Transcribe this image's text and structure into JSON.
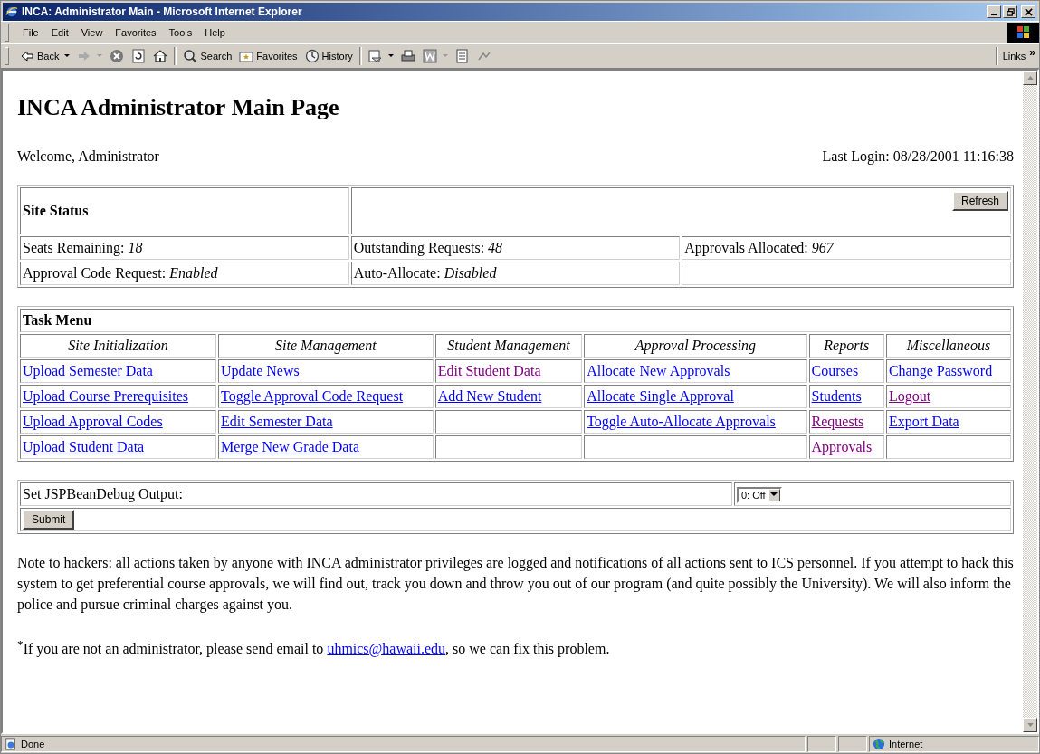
{
  "window": {
    "title": "INCA: Administrator Main - Microsoft Internet Explorer"
  },
  "menu": [
    "File",
    "Edit",
    "View",
    "Favorites",
    "Tools",
    "Help"
  ],
  "toolbar": [
    {
      "kind": "back",
      "label": "Back"
    },
    {
      "kind": "forward"
    },
    {
      "kind": "stop"
    },
    {
      "kind": "refresh"
    },
    {
      "kind": "home"
    },
    {
      "kind": "search",
      "label": "Search"
    },
    {
      "kind": "favorites",
      "label": "Favorites"
    },
    {
      "kind": "history",
      "label": "History"
    },
    {
      "kind": "mail"
    },
    {
      "kind": "print"
    },
    {
      "kind": "edit"
    },
    {
      "kind": "discuss"
    },
    {
      "kind": "messenger"
    }
  ],
  "links_bar": {
    "label": "Links",
    "chevron": "»"
  },
  "page": {
    "heading": "INCA Administrator Main Page",
    "welcome": "Welcome, Administrator",
    "last_login": "Last Login: 08/28/2001 11:16:38",
    "site_status": {
      "title": "Site Status",
      "refresh_button": "Refresh",
      "rows": [
        [
          {
            "label": "Seats Remaining:",
            "value": "18"
          },
          {
            "label": "Outstanding Requests:",
            "value": "48"
          },
          {
            "label": "Approvals Allocated:",
            "value": "967"
          }
        ],
        [
          {
            "label": "Approval Code Request:",
            "value": "Enabled"
          },
          {
            "label": "Auto-Allocate:",
            "value": "Disabled"
          }
        ]
      ]
    },
    "task_menu": {
      "title": "Task Menu",
      "columns": [
        {
          "heading": "Site Initialization",
          "links": [
            {
              "label": "Upload Semester Data",
              "visited": false
            },
            {
              "label": "Upload Course Prerequisites",
              "visited": false
            },
            {
              "label": "Upload Approval Codes",
              "visited": false
            },
            {
              "label": "Upload Student Data",
              "visited": false
            }
          ]
        },
        {
          "heading": "Site Management",
          "links": [
            {
              "label": "Update News",
              "visited": false
            },
            {
              "label": "Toggle Approval Code Request",
              "visited": false
            },
            {
              "label": "Edit Semester Data",
              "visited": false
            },
            {
              "label": "Merge New Grade Data",
              "visited": false
            }
          ]
        },
        {
          "heading": "Student Management",
          "links": [
            {
              "label": "Edit Student Data",
              "visited": true
            },
            {
              "label": "Add New Student",
              "visited": false
            }
          ]
        },
        {
          "heading": "Approval Processing",
          "links": [
            {
              "label": "Allocate New Approvals",
              "visited": false
            },
            {
              "label": "Allocate Single Approval",
              "visited": false
            },
            {
              "label": "Toggle Auto-Allocate Approvals",
              "visited": false
            }
          ]
        },
        {
          "heading": "Reports",
          "links": [
            {
              "label": "Courses",
              "visited": false
            },
            {
              "label": "Students",
              "visited": false
            },
            {
              "label": "Requests",
              "visited": true
            },
            {
              "label": "Approvals",
              "visited": true
            }
          ]
        },
        {
          "heading": "Miscellaneous",
          "links": [
            {
              "label": "Change Password",
              "visited": false
            },
            {
              "label": "Logout",
              "visited": true
            },
            {
              "label": "Export Data",
              "visited": false
            }
          ]
        }
      ]
    },
    "debug": {
      "label": "Set JSPBeanDebug Output:",
      "select_value": "0: Off",
      "submit": "Submit"
    },
    "note": "Note to hackers: all actions taken by anyone with INCA administrator privileges are logged and notifications of all actions sent to ICS personnel. If you attempt to hack this system to get preferential course approvals, we will find out, track you down and throw you out of our program (and quite possibly the University). We will also inform the police and pursue criminal charges against you.",
    "footnote": {
      "before": "$^{*}$If you are not an administrator, please send email to ",
      "email": "uhmics@hawaii.edu",
      "after": ", so we can fix this problem."
    }
  },
  "status_bar": {
    "text": "Done",
    "zone": "Internet"
  }
}
